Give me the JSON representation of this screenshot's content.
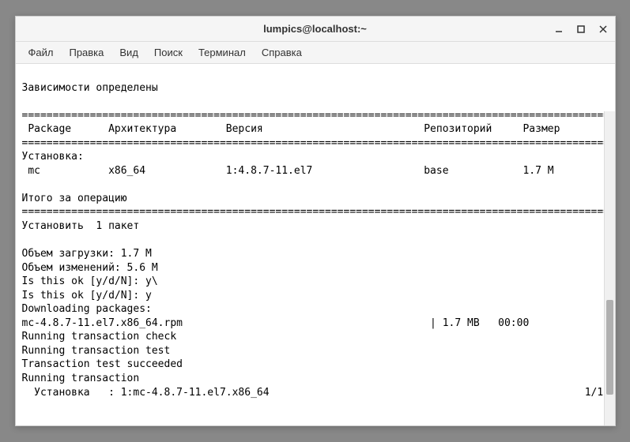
{
  "window": {
    "title": "lumpics@localhost:~"
  },
  "menubar": {
    "items": [
      "Файл",
      "Правка",
      "Вид",
      "Поиск",
      "Терминал",
      "Справка"
    ]
  },
  "terminal": {
    "lines": [
      "Зависимости определены",
      "",
      "================================================================================================",
      " Package      Архитектура        Версия                          Репозиторий     Размер",
      "================================================================================================",
      "Установка:",
      " mc           x86_64             1:4.8.7-11.el7                  base            1.7 M",
      "",
      "Итого за операцию",
      "================================================================================================",
      "Установить  1 пакет",
      "",
      "Объем загрузки: 1.7 M",
      "Объем изменений: 5.6 M",
      "Is this ok [y/d/N]: y\\",
      "Is this ok [y/d/N]: y",
      "Downloading packages:",
      "mc-4.8.7-11.el7.x86_64.rpm                                        | 1.7 MB   00:00",
      "Running transaction check",
      "Running transaction test",
      "Transaction test succeeded",
      "Running transaction",
      "  Установка   : 1:mc-4.8.7-11.el7.x86_64                                                   1/1"
    ]
  }
}
